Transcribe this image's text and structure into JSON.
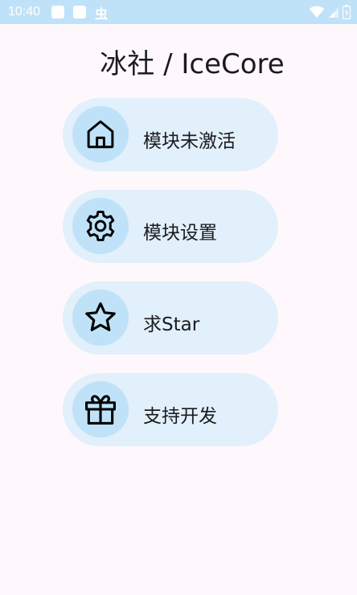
{
  "status_bar": {
    "time": "10:40",
    "icons": [
      "notification-square-icon",
      "notification-square-icon",
      "bug-icon",
      "wifi-icon",
      "cellular-signal-icon",
      "battery-icon"
    ],
    "bug_glyph": "虫"
  },
  "app": {
    "title": "冰社 / IceCore"
  },
  "menu": {
    "items": [
      {
        "label": "模块未激活",
        "icon": "home-icon"
      },
      {
        "label": "模块设置",
        "icon": "gear-icon"
      },
      {
        "label": "求Star",
        "icon": "star-icon"
      },
      {
        "label": "支持开发",
        "icon": "gift-icon"
      }
    ]
  },
  "colors": {
    "status_bar": "#bfe2f8",
    "background": "#fef8fd",
    "card": "#e1f0fb",
    "icon_circle": "#bfe2f8",
    "text": "#1b1b1f"
  }
}
